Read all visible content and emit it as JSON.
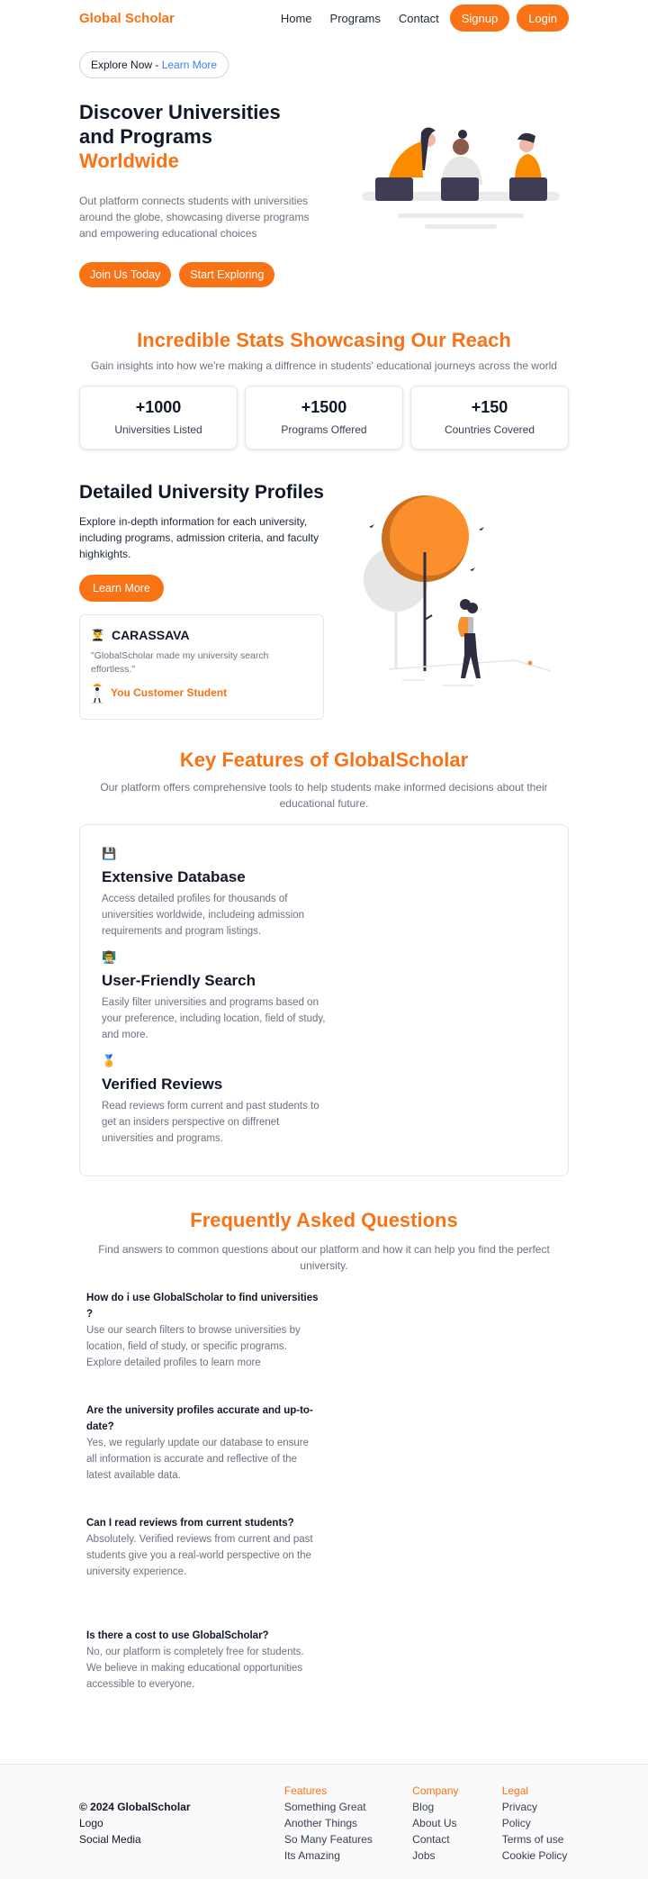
{
  "nav": {
    "brand": "Global Scholar",
    "links": [
      "Home",
      "Programs",
      "Contact"
    ],
    "signup": "Signup",
    "login": "Login"
  },
  "pill": {
    "text": "Explore Now - ",
    "link": "Learn More"
  },
  "hero": {
    "title_line1": "Discover Universities",
    "title_line2": "and Programs",
    "title_highlight": "Worldwide",
    "description": "Out platform connects students with universities around the globe, showcasing diverse programs and empowering educational choices",
    "cta_primary": "Join Us Today",
    "cta_secondary": "Start Exploring"
  },
  "stats": {
    "title": "Incredible Stats Showcasing Our Reach",
    "subtitle": "Gain insights into how we're making a diffrence in students' educational journeys across the world",
    "items": [
      {
        "value": "+1000",
        "label": "Universities Listed"
      },
      {
        "value": "+1500",
        "label": "Programs Offered"
      },
      {
        "value": "+150",
        "label": "Countries Covered"
      }
    ]
  },
  "profiles": {
    "title": "Detailed University Profiles",
    "description": "Explore in-depth information for each university, including programs, admission criteria, and faculty highkights.",
    "button": "Learn More",
    "testimonial": {
      "icon": "👨‍🎓",
      "name": "CARASSAVA",
      "quote": "\"GlobalScholar made my university search effortless.\"",
      "author": "You Customer Student"
    }
  },
  "features": {
    "title": "Key Features of GlobalScholar",
    "subtitle": "Our platform offers comprehensive tools to help students make informed decisions about their educational future.",
    "items": [
      {
        "icon": "💾",
        "title": "Extensive Database",
        "description": "Access detailed profiles for thousands of universities worldwide, includeing admission requirements and program listings."
      },
      {
        "icon": "👨‍🏫",
        "title": "User-Friendly Search",
        "description": "Easily filter universities and programs based on your preference, including location, field of study, and more."
      },
      {
        "icon": "🏅",
        "title": "Verified Reviews",
        "description": "Read reviews form current and past students to get an insiders perspective on diffrenet universities and programs."
      }
    ]
  },
  "faq": {
    "title": "Frequently Asked Questions",
    "subtitle": "Find answers to common questions about our platform and how it can help you find the perfect university.",
    "items": [
      {
        "q": "How do i use GlobalScholar to find universities ?",
        "a": "Use our search filters to browse universities by location, field of study, or specific programs. Explore detailed profiles to learn more"
      },
      {
        "q": "Are the university profiles accurate and up-to-date?",
        "a": "Yes, we regularly update our database to ensure all information is accurate and reflective of the latest available data."
      },
      {
        "q": "Can I read reviews from current students?",
        "a": "Absolutely. Verified reviews from current and past students give you a real-world perspective on the university experience."
      },
      {
        "q": "Is there a cost to use GlobalScholar?",
        "a": "No, our platform is completely free for students. We believe in making educational opportunities accessible to everyone."
      }
    ]
  },
  "footer": {
    "copyright": "© 2024 GlobalScholar",
    "left_items": [
      "Logo",
      "Social Media"
    ],
    "columns": [
      {
        "heading": "Features",
        "links": [
          "Something Great",
          "Another Things",
          "So Many Features",
          "Its Amazing"
        ]
      },
      {
        "heading": "Company",
        "links": [
          "Blog",
          "About Us",
          "Contact",
          "Jobs"
        ]
      },
      {
        "heading": "Legal",
        "links": [
          "Privacy Policy",
          "Terms of use",
          "Cookie Policy"
        ]
      }
    ]
  },
  "colors": {
    "accent": "#f97316",
    "link": "#3b82f6",
    "text": "#111827",
    "muted": "#6b7280"
  }
}
